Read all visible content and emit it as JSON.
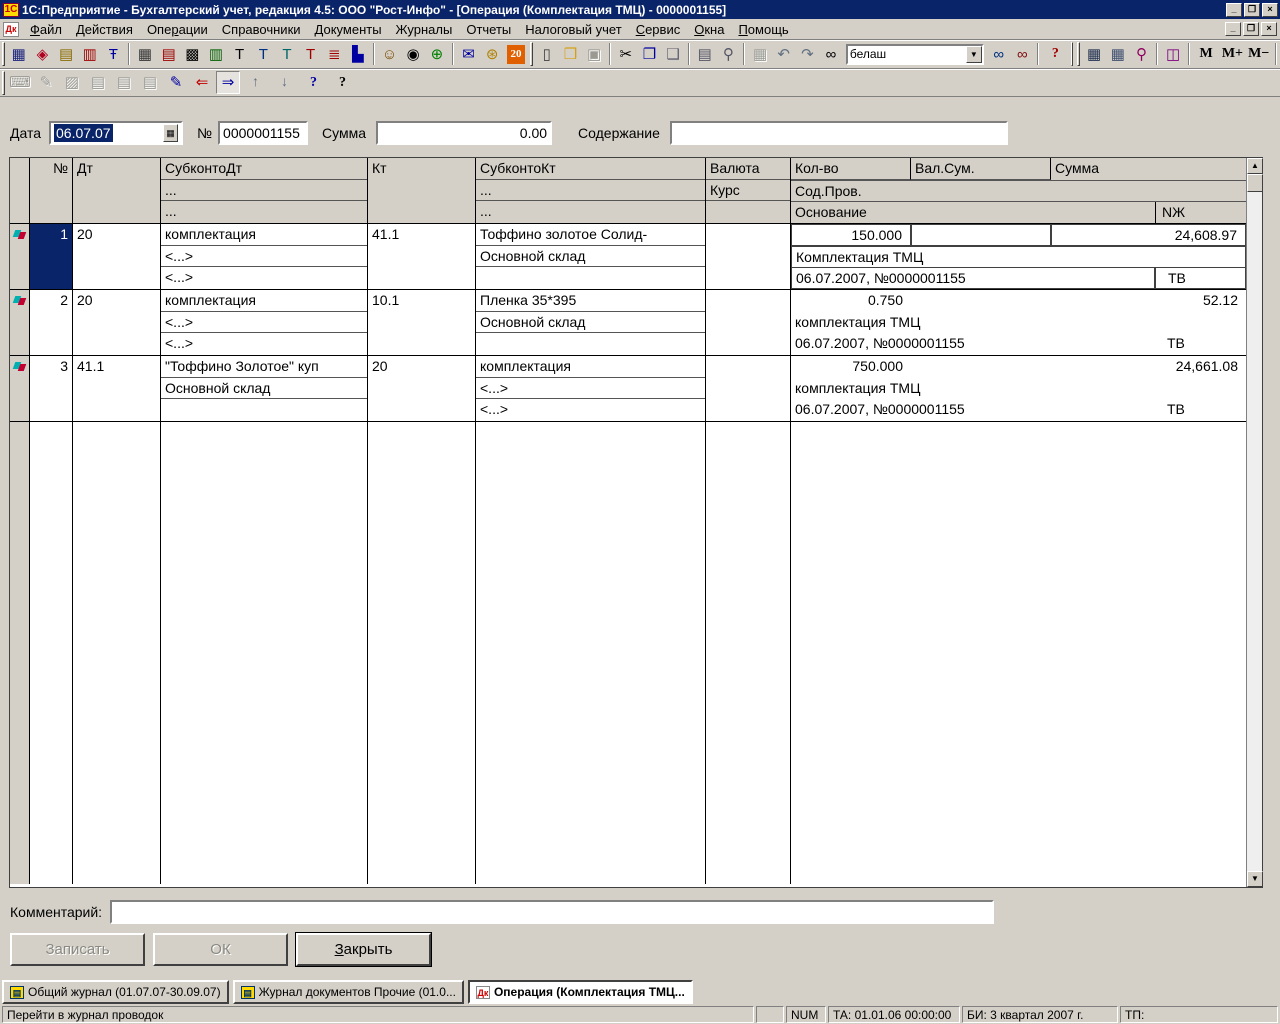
{
  "window": {
    "title": "1С:Предприятие - Бухгалтерский учет, редакция 4.5: ООО \"Рост-Инфо\" - [Операция (Комплектация ТМЦ) - 0000001155]",
    "app_icon_text": "1С",
    "mdi_icon_text": "Дк",
    "minimize": "_",
    "restore": "❐",
    "close": "×"
  },
  "menu": {
    "items": [
      {
        "label": "Файл",
        "accel": 0
      },
      {
        "label": "Действия",
        "accel": 0
      },
      {
        "label": "Операции",
        "accel": 3
      },
      {
        "label": "Справочники",
        "accel": -1
      },
      {
        "label": "Документы",
        "accel": -1
      },
      {
        "label": "Журналы",
        "accel": -1
      },
      {
        "label": "Отчеты",
        "accel": -1
      },
      {
        "label": "Налоговый учет",
        "accel": -1
      },
      {
        "label": "Сервис",
        "accel": 0
      },
      {
        "label": "Окна",
        "accel": 0
      },
      {
        "label": "Помощь",
        "accel": 0
      }
    ]
  },
  "toolbar1": [
    {
      "t": "handle"
    },
    {
      "t": "btn",
      "name": "chart-of-accounts-icon",
      "g": "▦",
      "c": "#1a237e"
    },
    {
      "t": "btn",
      "name": "subconto-types-icon",
      "g": "◈",
      "c": "#b00020"
    },
    {
      "t": "btn",
      "name": "operations-journal-icon",
      "g": "▤",
      "c": "#8a6d00"
    },
    {
      "t": "btn",
      "name": "documents-journal-icon",
      "g": "▥",
      "c": "#a00000"
    },
    {
      "t": "btn",
      "name": "account-turnovers-icon",
      "g": "Ŧ",
      "c": "#0000a0"
    },
    {
      "t": "sep"
    },
    {
      "t": "btn",
      "name": "journal-operations-icon",
      "g": "▦",
      "c": "#333333"
    },
    {
      "t": "btn",
      "name": "journal-postings-icon",
      "g": "▤",
      "c": "#a00000"
    },
    {
      "t": "btn",
      "name": "chessboard-report-icon",
      "g": "▩",
      "c": "#000000"
    },
    {
      "t": "btn",
      "name": "account-analysis-icon",
      "g": "▥",
      "c": "#006000"
    },
    {
      "t": "btn",
      "name": "document-blank-icon",
      "g": "T",
      "c": "#000000"
    },
    {
      "t": "btn",
      "name": "document-input-icon",
      "g": "T",
      "c": "#003080"
    },
    {
      "t": "btn",
      "name": "document-lines-icon",
      "g": "T",
      "c": "#006666"
    },
    {
      "t": "btn",
      "name": "document-mark-icon",
      "g": "T",
      "c": "#a00000"
    },
    {
      "t": "btn",
      "name": "report-icon",
      "g": "≣",
      "c": "#a00000"
    },
    {
      "t": "btn",
      "name": "diagram-icon",
      "g": "▙",
      "c": "#0000a0"
    },
    {
      "t": "sep"
    },
    {
      "t": "btn",
      "name": "assistant-icon",
      "g": "☺",
      "c": "#7a4a00"
    },
    {
      "t": "btn",
      "name": "video-camera-icon",
      "g": "◉",
      "c": "#000000"
    },
    {
      "t": "btn",
      "name": "internet-globe-icon",
      "g": "⊕",
      "c": "#008000"
    },
    {
      "t": "sep"
    },
    {
      "t": "btn",
      "name": "mail-icon",
      "g": "✉",
      "c": "#0000a0"
    },
    {
      "t": "btn",
      "name": "web-update-icon",
      "g": "⊛",
      "c": "#b08000"
    },
    {
      "t": "btn",
      "name": "calendar-date-icon",
      "g": "20",
      "c": "#ffffff",
      "bg": "#e06000",
      "text": true
    },
    {
      "t": "handle"
    },
    {
      "t": "btn",
      "name": "new-document-icon",
      "g": "▯",
      "c": "#404040"
    },
    {
      "t": "btn",
      "name": "open-file-icon",
      "g": "❒",
      "c": "#d4a017"
    },
    {
      "t": "btn",
      "name": "save-icon",
      "g": "▣",
      "c": "#808080",
      "disabled": true
    },
    {
      "t": "sep"
    },
    {
      "t": "btn",
      "name": "cut-icon",
      "g": "✂",
      "c": "#000000"
    },
    {
      "t": "btn",
      "name": "copy-icon",
      "g": "❐",
      "c": "#0000a0"
    },
    {
      "t": "btn",
      "name": "paste-icon",
      "g": "❑",
      "c": "#606070"
    },
    {
      "t": "sep"
    },
    {
      "t": "btn",
      "name": "print-icon",
      "g": "▤",
      "c": "#556"
    },
    {
      "t": "btn",
      "name": "print-preview-icon",
      "g": "⚲",
      "c": "#556"
    },
    {
      "t": "sep"
    },
    {
      "t": "btn",
      "name": "table-fix-icon",
      "g": "▦",
      "c": "#909090",
      "disabled": true
    },
    {
      "t": "btn",
      "name": "undo-icon",
      "g": "↶",
      "c": "#607080"
    },
    {
      "t": "btn",
      "name": "redo-icon",
      "g": "↷",
      "c": "#607080"
    },
    {
      "t": "btn",
      "name": "find-icon",
      "g": "∞",
      "c": "#000000"
    },
    {
      "t": "combo",
      "name": "search-combobox"
    },
    {
      "t": "btn",
      "name": "find-next-icon",
      "g": "∞",
      "c": "#003080"
    },
    {
      "t": "btn",
      "name": "find-previous-icon",
      "g": "∞",
      "c": "#801010"
    },
    {
      "t": "sep"
    },
    {
      "t": "btn",
      "name": "help-icon",
      "g": "?",
      "c": "#a00000",
      "text": true
    },
    {
      "t": "handle"
    },
    {
      "t": "handle"
    },
    {
      "t": "btn",
      "name": "calculator-icon",
      "g": "▦",
      "c": "#203050"
    },
    {
      "t": "btn",
      "name": "fixed-calc-icon",
      "g": "▦",
      "c": "#405070"
    },
    {
      "t": "btn",
      "name": "tablo-icon",
      "g": "⚲",
      "c": "#900060"
    },
    {
      "t": "sep"
    },
    {
      "t": "btn",
      "name": "description-book-icon",
      "g": "◫",
      "c": "#800080"
    },
    {
      "t": "sep"
    },
    {
      "t": "btn",
      "name": "memory-recall-button",
      "g": "M",
      "c": "#000000",
      "text": true
    },
    {
      "t": "btn",
      "name": "memory-add-button",
      "g": "M+",
      "c": "#000000",
      "text": true
    },
    {
      "t": "btn",
      "name": "memory-subtract-button",
      "g": "M−",
      "c": "#000000",
      "text": true
    },
    {
      "t": "sep"
    }
  ],
  "toolbar2": [
    {
      "t": "handle"
    },
    {
      "t": "btn",
      "name": "keyboard-input-icon",
      "g": "⌨",
      "c": "#909090",
      "disabled": true
    },
    {
      "t": "btn",
      "name": "edit-cell-icon",
      "g": "✎",
      "c": "#909090",
      "disabled": true
    },
    {
      "t": "btn",
      "name": "pattern-icon",
      "g": "▨",
      "c": "#909090",
      "disabled": true
    },
    {
      "t": "btn",
      "name": "add-row-icon",
      "g": "▤",
      "c": "#909090",
      "disabled": true
    },
    {
      "t": "btn",
      "name": "delete-row-icon",
      "g": "▤",
      "c": "#909090",
      "disabled": true
    },
    {
      "t": "btn",
      "name": "copy-row-icon",
      "g": "▤",
      "c": "#909090",
      "disabled": true
    },
    {
      "t": "btn",
      "name": "edit-document-icon",
      "g": "✎",
      "c": "#0000a0"
    },
    {
      "t": "btn",
      "name": "goto-source-icon",
      "g": "⇐",
      "c": "#c00000"
    },
    {
      "t": "btn",
      "name": "show-postings-icon",
      "g": "⇒",
      "c": "#0000a0",
      "pressed": true
    },
    {
      "t": "btn",
      "name": "move-up-icon",
      "g": "↑",
      "c": "#607080",
      "text": true
    },
    {
      "t": "btn",
      "name": "move-down-icon",
      "g": "↓",
      "c": "#607080",
      "text": true
    },
    {
      "t": "btn",
      "name": "help-topic-icon",
      "g": "?",
      "c": "#0000a0",
      "text": true
    },
    {
      "t": "btn",
      "name": "context-help-icon",
      "g": "?",
      "c": "#000000",
      "text": true
    }
  ],
  "search": {
    "value": "белаш"
  },
  "form": {
    "date_label": "Дата",
    "date_value": "06.07.07",
    "number_label": "№",
    "number_value": "0000001155",
    "sum_label": "Сумма",
    "sum_value": "0.00",
    "content_label": "Содержание",
    "content_value": "",
    "comment_label": "Комментарий:",
    "comment_value": ""
  },
  "table": {
    "header": {
      "num": "№",
      "dt": "Дт",
      "subdt": "СубконтоДт",
      "kt": "Кт",
      "subkt": "СубконтоКт",
      "currency": "Валюта",
      "rate": "Курс",
      "qty": "Кол-во",
      "cursum": "Вал.Сум.",
      "sum": "Сумма",
      "content": "Сод.Пров.",
      "basis": "Основание",
      "nj": "NЖ",
      "dots": "..."
    },
    "rows": [
      {
        "num": "1",
        "selected": true,
        "boxed": true,
        "dt": "20",
        "kt": "41.1",
        "sub_dt": [
          "комплектация",
          "<...>",
          "<...>"
        ],
        "sub_kt": [
          "Тоффино золотое Солид-",
          "Основной склад",
          ""
        ],
        "qty": "150.000",
        "cursum": "",
        "sum": "24,608.97",
        "content": "Комплектация ТМЦ",
        "basis": "06.07.2007, №0000001155",
        "nj": "ТВ"
      },
      {
        "num": "2",
        "selected": false,
        "boxed": false,
        "dt": "20",
        "kt": "10.1",
        "sub_dt": [
          "комплектация",
          "<...>",
          "<...>"
        ],
        "sub_kt": [
          "Пленка 35*395",
          "Основной склад",
          ""
        ],
        "qty": "0.750",
        "cursum": "",
        "sum": "52.12",
        "content": "комплектация ТМЦ",
        "basis": "06.07.2007, №0000001155",
        "nj": "ТВ"
      },
      {
        "num": "3",
        "selected": false,
        "boxed": false,
        "dt": "41.1",
        "kt": "20",
        "sub_dt": [
          "\"Тоффино Золотое\" куп",
          "Основной склад",
          ""
        ],
        "sub_kt": [
          "комплектация",
          "<...>",
          "<...>"
        ],
        "qty": "750.000",
        "cursum": "",
        "sum": "24,661.08",
        "content": "комплектация ТМЦ",
        "basis": "06.07.2007, №0000001155",
        "nj": "ТВ"
      }
    ],
    "empty_row_count": 7
  },
  "buttons": [
    {
      "label": "Записать",
      "enabled": false,
      "accel": -1
    },
    {
      "label": "ОК",
      "enabled": false,
      "accel": -1
    },
    {
      "label": "Закрыть",
      "enabled": true,
      "accel": 0,
      "default": true
    }
  ],
  "tabs": [
    {
      "label": "Общий журнал (01.07.07-30.09.07)",
      "icon": "journal",
      "active": false
    },
    {
      "label": "Журнал документов Прочие (01.0...",
      "icon": "journal",
      "active": false
    },
    {
      "label": "Операция (Комплектация ТМЦ...",
      "icon": "operation",
      "active": true
    }
  ],
  "statusbar": {
    "hint": "Перейти в журнал проводок",
    "num_lock": "NUM",
    "ta": "ТА: 01.01.06  00:00:00",
    "bi": "БИ: 3 квартал 2007 г.",
    "tp": "ТП:"
  },
  "colors": {
    "titlebar": "#0a246a",
    "selection": "#0a246a",
    "chrome": "#d4d0c8"
  }
}
